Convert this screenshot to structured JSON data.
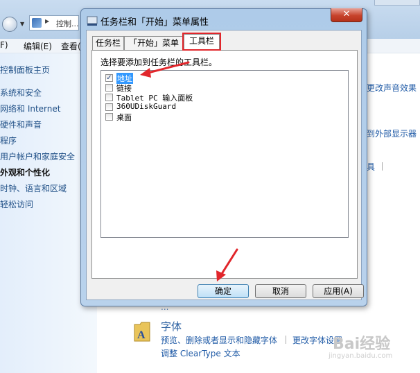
{
  "background": {
    "address": "控制...",
    "menu": [
      "F)",
      "编辑(E)",
      "查看("
    ],
    "left_links": [
      "控制面板主页",
      "系统和安全",
      "网络和 Internet",
      "硬件和声音",
      "程序",
      "用户帐户和家庭安全",
      "外观和个性化",
      "时钟、语言和区域",
      "轻松访问"
    ],
    "active_left_link": "外观和个性化",
    "right_partial": [
      "更改声音效果",
      "到外部显示器",
      "具"
    ],
    "hidden_row": "...",
    "fonts": {
      "heading": "字体",
      "links": [
        "预览、删除或者显示和隐藏字体",
        "更改字体设置",
        "调整 ClearType 文本"
      ]
    }
  },
  "dialog": {
    "title": "任务栏和「开始」菜单属性",
    "close": "✕",
    "tabs": [
      "任务栏",
      "「开始」菜单",
      "工具栏"
    ],
    "active_tab": "工具栏",
    "instruction": "选择要添加到任务栏的工具栏。",
    "toolbars": [
      {
        "label": "地址",
        "checked": true
      },
      {
        "label": "链接",
        "checked": false
      },
      {
        "label": "Tablet PC 输入面板",
        "checked": false
      },
      {
        "label": "360UDiskGuard",
        "checked": false
      },
      {
        "label": "桌面",
        "checked": false
      }
    ],
    "buttons": {
      "ok": "确定",
      "cancel": "取消",
      "apply": "应用(A)"
    }
  },
  "colors": {
    "highlight_red": "#e1262b",
    "selection": "#3399ff"
  },
  "watermark": {
    "text": "Bai经验",
    "sub": "jingyan.baidu.com"
  }
}
